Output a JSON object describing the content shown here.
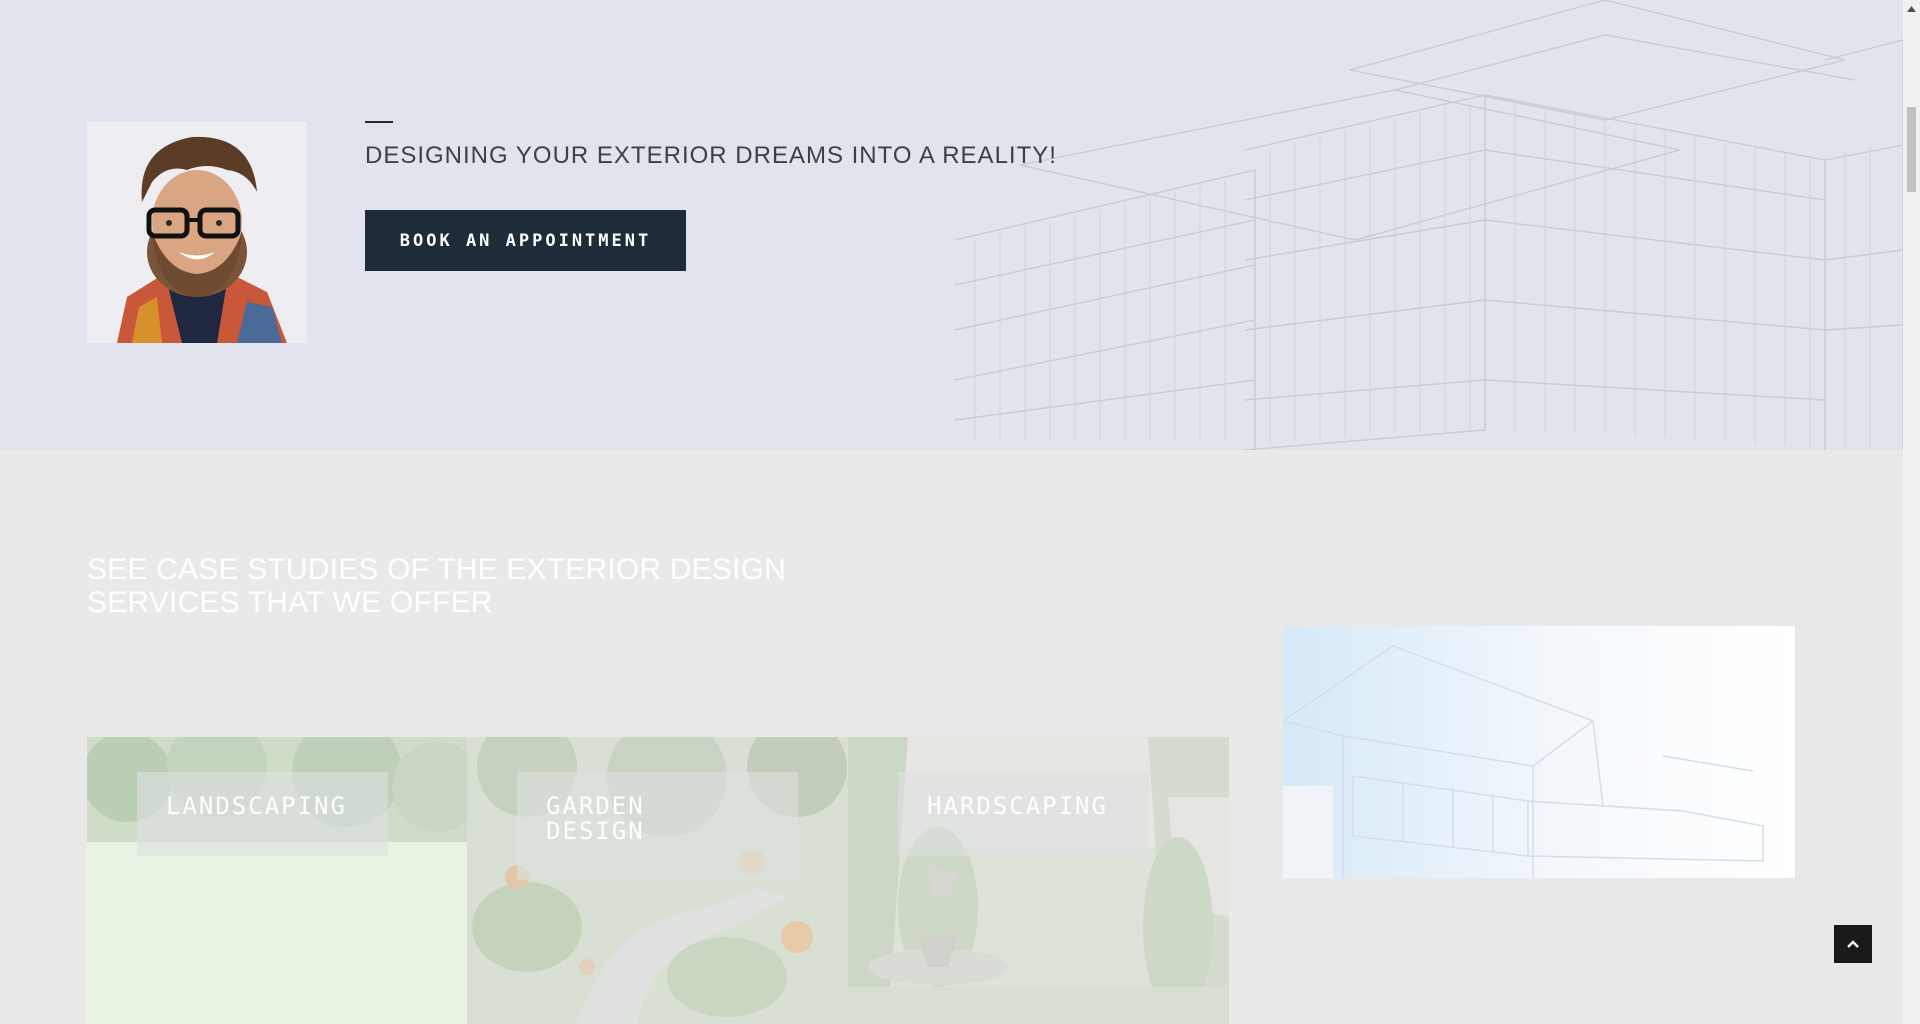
{
  "hero": {
    "tagline": "DESIGNING YOUR EXTERIOR DREAMS INTO A REALITY!",
    "book_button": "BOOK AN APPOINTMENT"
  },
  "cases": {
    "heading_line1": "SEE CASE STUDIES OF THE EXTERIOR DESIGN",
    "heading_line2": "SERVICES THAT WE OFFER",
    "cards": [
      {
        "label": "LANDSCAPING"
      },
      {
        "label_line1": "GARDEN",
        "label_line2": "DESIGN"
      },
      {
        "label": "HARDSCAPING"
      }
    ]
  },
  "colors": {
    "hero_bg": "#e1e4ec",
    "section_bg": "#e9e9ea",
    "button_bg": "#1f2b38",
    "scroll_top_bg": "#1a1a1a"
  },
  "icons": {
    "scroll_top": "chevron-up-icon",
    "scrollbar_up": "triangle-up-icon"
  }
}
